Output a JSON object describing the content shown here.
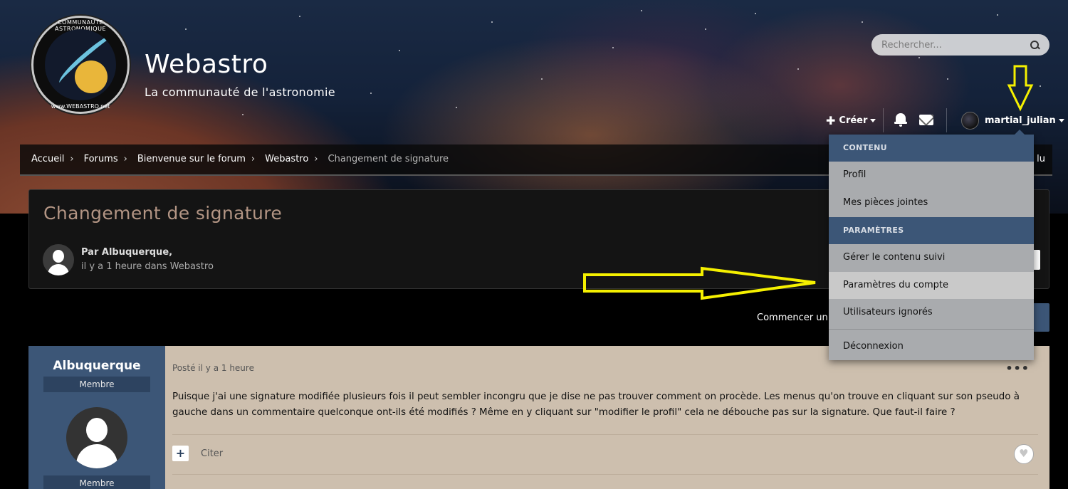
{
  "site": {
    "title": "Webastro",
    "tagline": "La communauté de l'astronomie",
    "logo_text_top": "COMMUNAUTE ASTRONOMIQUE",
    "logo_text_bottom": "www.WEBASTRO.net"
  },
  "search": {
    "placeholder": "Rechercher..."
  },
  "userbar": {
    "create_label": "Créer",
    "username": "martial_julian"
  },
  "breadcrumb": {
    "items": [
      "Accueil",
      "Forums",
      "Bienvenue sur le forum",
      "Webastro"
    ],
    "current": "Changement de signature",
    "right_text": "e lu"
  },
  "topic": {
    "title": "Changement de signature",
    "author": "Par Albuquerque,",
    "posted_in": "il y a 1 heure dans Webastro",
    "start_topic": "Commencer un n"
  },
  "post": {
    "author": "Albuquerque",
    "rank": "Membre",
    "rank_bottom": "Membre",
    "time": "Posté il y a 1 heure",
    "more": "•••",
    "body": "Puisque j'ai une signature modifiée plusieurs fois il peut sembler incongru que je dise ne pas trouver comment on procède. Les menus qu'on trouve en cliquant sur son pseudo à gauche  dans un commentaire quelconque ont-ils été modifiés ? Même en y cliquant sur \"modifier le profil\" cela ne débouche pas sur la signature.  Que faut-il faire ?",
    "plus": "+",
    "quote": "Citer"
  },
  "menu": {
    "section_content": "CONTENU",
    "profile": "Profil",
    "attachments": "Mes pièces jointes",
    "section_settings": "PARAMÈTRES",
    "followed": "Gérer le contenu suivi",
    "account_settings": "Paramètres du compte",
    "ignored_users": "Utilisateurs ignorés",
    "logout": "Déconnexion"
  },
  "colors": {
    "accent": "#3c5677",
    "annotation": "#f5f000",
    "post_bg": "#cdbfae",
    "topic_title": "#b39584"
  },
  "icons": [
    "search-icon",
    "plus-icon",
    "bell-icon",
    "envelope-icon",
    "heart-icon",
    "ellipsis-icon",
    "user-avatar-icon"
  ]
}
